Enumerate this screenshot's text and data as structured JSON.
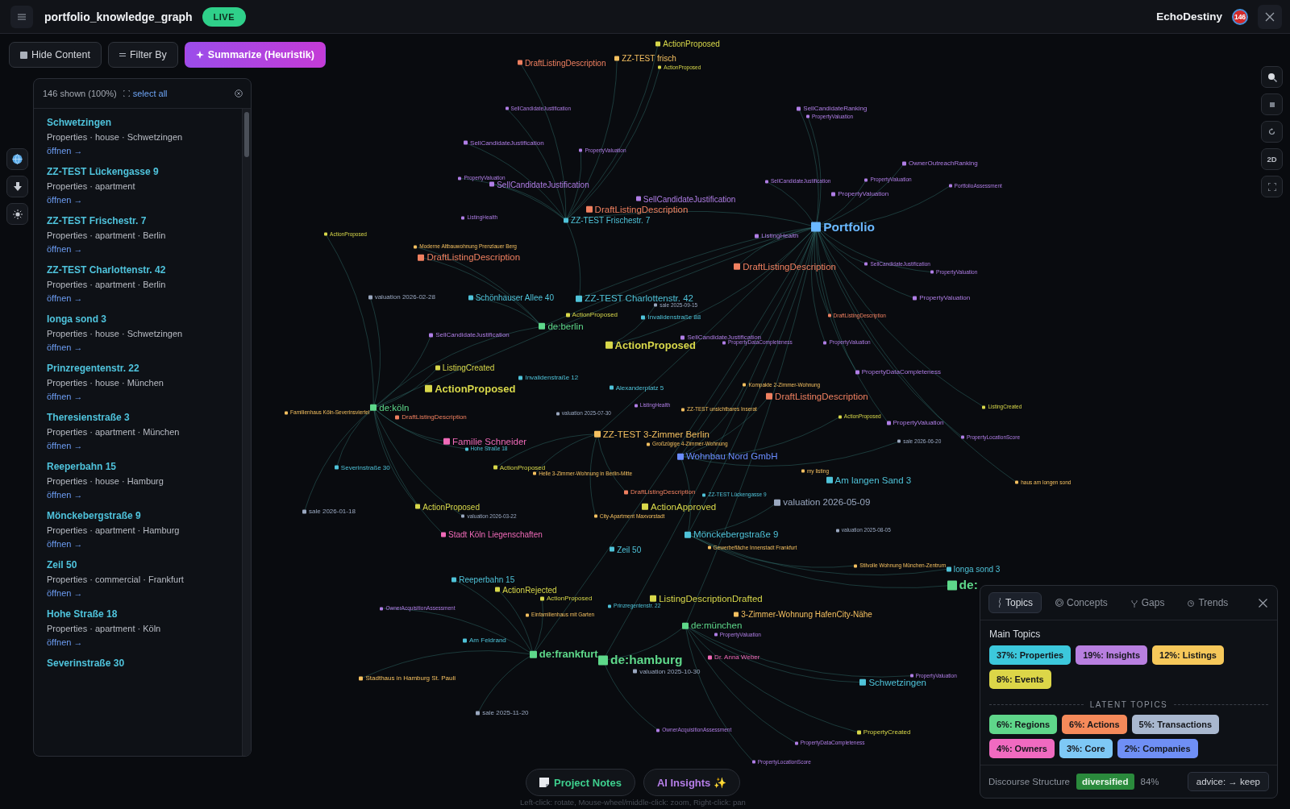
{
  "header": {
    "title": "portfolio_knowledge_graph",
    "status": "LIVE",
    "user": "EchoDestiny",
    "notification_count": "146"
  },
  "toolbar": [
    {
      "label": "Hide Content",
      "kind": "hide"
    },
    {
      "label": "Filter By",
      "kind": "filter"
    },
    {
      "label": "Summarize (Heuristik)",
      "kind": "summarize"
    }
  ],
  "list": {
    "count": "146 shown (100%)",
    "select_all": "select all",
    "items": [
      {
        "title": "Schwetzingen",
        "meta": "Properties · house · Schwetzingen",
        "link": "öffnen →"
      },
      {
        "title": "ZZ-TEST Lückengasse 9",
        "meta": "Properties · apartment",
        "link": "öffnen →"
      },
      {
        "title": "ZZ-TEST Frischestr. 7",
        "meta": "Properties · apartment · Berlin",
        "link": "öffnen →"
      },
      {
        "title": "ZZ-TEST Charlottenstr. 42",
        "meta": "Properties · apartment · Berlin",
        "link": "öffnen →"
      },
      {
        "title": "Ionga sond 3",
        "meta": "Properties · house · Schwetzingen",
        "link": "öffnen →"
      },
      {
        "title": "Prinzregentenstr. 22",
        "meta": "Properties · house · München",
        "link": "öffnen →"
      },
      {
        "title": "Theresienstraße 3",
        "meta": "Properties · apartment · München",
        "link": "öffnen →"
      },
      {
        "title": "Reeperbahn 15",
        "meta": "Properties · house · Hamburg",
        "link": "öffnen →"
      },
      {
        "title": "Mönckebergstraße 9",
        "meta": "Properties · apartment · Hamburg",
        "link": "öffnen →"
      },
      {
        "title": "Zeil 50",
        "meta": "Properties · commercial · Frankfurt",
        "link": "öffnen →"
      },
      {
        "title": "Hohe Straße 18",
        "meta": "Properties · apartment · Köln",
        "link": "öffnen →"
      },
      {
        "title": "Severinstraße 30"
      }
    ]
  },
  "view_mode": "2D",
  "graph": {
    "nodes": [
      {
        "label": "ActionProposed",
        "color": "#d8d84a"
      },
      {
        "label": "ZZ-TEST frisch",
        "color": "#f5c060"
      },
      {
        "label": "ActionProposed",
        "color": "#d8d84a"
      },
      {
        "label": "DraftListingDescription",
        "color": "#f08060"
      },
      {
        "label": "SellCandidateJustification",
        "color": "#b07ee6"
      },
      {
        "label": "SellCandidateJustification",
        "color": "#b07ee6"
      },
      {
        "label": "PropertyValuation",
        "color": "#b07ee6"
      },
      {
        "label": "SellCandidateRanking",
        "color": "#b07ee6"
      },
      {
        "label": "PropertyValuation",
        "color": "#b07ee6"
      },
      {
        "label": "OwnerOutreachRanking",
        "color": "#b07ee6"
      },
      {
        "label": "PropertyValuation",
        "color": "#b07ee6"
      },
      {
        "label": "PortfolioAssessment",
        "color": "#b07ee6"
      },
      {
        "label": "SellCandidateJustification",
        "color": "#b07ee6"
      },
      {
        "label": "PropertyValuation",
        "color": "#b07ee6"
      },
      {
        "label": "SellCandidateJustification",
        "color": "#b07ee6"
      },
      {
        "label": "PropertyValuation",
        "color": "#b07ee6"
      },
      {
        "label": "SellCandidateJustification",
        "color": "#b07ee6"
      },
      {
        "label": "ListingHealth",
        "color": "#b07ee6"
      },
      {
        "label": "DraftListingDescription",
        "color": "#f08060"
      },
      {
        "label": "ZZ-TEST Frischestr. 7",
        "color": "#4fc3d9"
      },
      {
        "label": "Portfolio",
        "color": "#6ab8ff"
      },
      {
        "label": "ListingHealth",
        "color": "#b07ee6"
      },
      {
        "label": "ActionProposed",
        "color": "#d8d84a"
      },
      {
        "label": "Moderne Altbauwohnung Prenzlauer Berg",
        "color": "#f5c060"
      },
      {
        "label": "DraftListingDescription",
        "color": "#f08060"
      },
      {
        "label": "DraftListingDescription",
        "color": "#f08060"
      },
      {
        "label": "SellCandidateJustification",
        "color": "#b07ee6"
      },
      {
        "label": "PropertyValuation",
        "color": "#b07ee6"
      },
      {
        "label": "valuation 2026-02-28",
        "color": "#9aa8c0"
      },
      {
        "label": "Schönhauser Allee 40",
        "color": "#4fc3d9"
      },
      {
        "label": "ZZ-TEST Charlottenstr. 42",
        "color": "#4fc3d9"
      },
      {
        "label": "PropertyValuation",
        "color": "#b07ee6"
      },
      {
        "label": "sale 2025-09-15",
        "color": "#9aa8c0"
      },
      {
        "label": "ActionProposed",
        "color": "#d8d84a"
      },
      {
        "label": "Invalidenstraße 88",
        "color": "#4fc3d9"
      },
      {
        "label": "DraftListingDescription",
        "color": "#f08060"
      },
      {
        "label": "de:berlin",
        "color": "#5ed88a"
      },
      {
        "label": "SellCandidateJustification",
        "color": "#b07ee6"
      },
      {
        "label": "ActionProposed",
        "color": "#d8d84a"
      },
      {
        "label": "SellCandidateJustification",
        "color": "#b07ee6"
      },
      {
        "label": "PropertyDataCompleteness",
        "color": "#b07ee6"
      },
      {
        "label": "PropertyValuation",
        "color": "#b07ee6"
      },
      {
        "label": "ListingCreated",
        "color": "#d8d84a"
      },
      {
        "label": "Invalidenstraße 12",
        "color": "#4fc3d9"
      },
      {
        "label": "PropertyDataCompleteness",
        "color": "#b07ee6"
      },
      {
        "label": "ActionProposed",
        "color": "#d8d84a"
      },
      {
        "label": "Alexanderplatz 5",
        "color": "#4fc3d9"
      },
      {
        "label": "Kompakte 2-Zimmer-Wohnung",
        "color": "#f5c060"
      },
      {
        "label": "DraftListingDescription",
        "color": "#f08060"
      },
      {
        "label": "Familienhaus Köln-Severinsviertel",
        "color": "#f5c060"
      },
      {
        "label": "de:köln",
        "color": "#5ed88a"
      },
      {
        "label": "DraftListingDescription",
        "color": "#f08060"
      },
      {
        "label": "valuation 2025-07-30",
        "color": "#9aa8c0"
      },
      {
        "label": "ListingHealth",
        "color": "#b07ee6"
      },
      {
        "label": "ZZ-TEST unsichtbares Inserat",
        "color": "#f5c060"
      },
      {
        "label": "ActionProposed",
        "color": "#d8d84a"
      },
      {
        "label": "PropertyValuation",
        "color": "#b07ee6"
      },
      {
        "label": "ListingCreated",
        "color": "#d8d84a"
      },
      {
        "label": "Familie Schneider",
        "color": "#f06ab8"
      },
      {
        "label": "Hohe Straße 18",
        "color": "#4fc3d9"
      },
      {
        "label": "ZZ-TEST 3-Zimmer Berlin",
        "color": "#f5c060"
      },
      {
        "label": "Großzügige 4-Zimmer-Wohnung",
        "color": "#f5c060"
      },
      {
        "label": "Wohnbau Nord GmbH",
        "color": "#6a8cff"
      },
      {
        "label": "sale 2026-06-20",
        "color": "#9aa8c0"
      },
      {
        "label": "PropertyLocationScore",
        "color": "#b07ee6"
      },
      {
        "label": "Severinstraße 30",
        "color": "#4fc3d9"
      },
      {
        "label": "ActionProposed",
        "color": "#d8d84a"
      },
      {
        "label": "Helle 3-Zimmer-Wohnung in Berlin-Mitte",
        "color": "#f5c060"
      },
      {
        "label": "my listing",
        "color": "#f5c060"
      },
      {
        "label": "Am langen Sand 3",
        "color": "#4fc3d9"
      },
      {
        "label": "haus am longen sond",
        "color": "#f5c060"
      },
      {
        "label": "sale 2026-01-18",
        "color": "#9aa8c0"
      },
      {
        "label": "ActionProposed",
        "color": "#d8d84a"
      },
      {
        "label": "DraftListingDescription",
        "color": "#f08060"
      },
      {
        "label": "ActionApproved",
        "color": "#d8d84a"
      },
      {
        "label": "ZZ-TEST Lückengasse 9",
        "color": "#4fc3d9"
      },
      {
        "label": "valuation 2026-05-09",
        "color": "#9aa8c0"
      },
      {
        "label": "valuation 2026-03-22",
        "color": "#9aa8c0"
      },
      {
        "label": "City-Apartment Maxvorstadt",
        "color": "#f5c060"
      },
      {
        "label": "Stadt Köln Liegenschaften",
        "color": "#f06ab8"
      },
      {
        "label": "Mönckebergstraße 9",
        "color": "#4fc3d9"
      },
      {
        "label": "valuation 2025-08-05",
        "color": "#9aa8c0"
      },
      {
        "label": "Zeil 50",
        "color": "#4fc3d9"
      },
      {
        "label": "Gewerbefläche Innenstadt Frankfurt",
        "color": "#f5c060"
      },
      {
        "label": "Stilvolle Wohnung München-Zentrum",
        "color": "#f5c060"
      },
      {
        "label": "Ionga sond 3",
        "color": "#4fc3d9"
      },
      {
        "label": "Reeperbahn 15",
        "color": "#4fc3d9"
      },
      {
        "label": "ActionRejected",
        "color": "#d8d84a"
      },
      {
        "label": "de:",
        "color": "#5ed88a"
      },
      {
        "label": "ActionProposed",
        "color": "#d8d84a"
      },
      {
        "label": "ListingDescriptionDrafted",
        "color": "#d8d84a"
      },
      {
        "label": "OwnerAcquisitionAssessment",
        "color": "#b07ee6"
      },
      {
        "label": "Einfamilienhaus mit Garten",
        "color": "#f5c060"
      },
      {
        "label": "Prinzregentenstr. 22",
        "color": "#4fc3d9"
      },
      {
        "label": "3-Zimmer-Wohnung HafenCity-Nähe",
        "color": "#f5c060"
      },
      {
        "label": "de:münchen",
        "color": "#5ed88a"
      },
      {
        "label": "PropertyValuation",
        "color": "#b07ee6"
      },
      {
        "label": "Am Feldrand",
        "color": "#4fc3d9"
      },
      {
        "label": "de:frankfurt",
        "color": "#5ed88a"
      },
      {
        "label": "de:hamburg",
        "color": "#5ed88a"
      },
      {
        "label": "Dr. Anna Weber",
        "color": "#f06ab8"
      },
      {
        "label": "Stadthaus in Hamburg St. Pauli",
        "color": "#f5c060"
      },
      {
        "label": "valuation 2025-10-30",
        "color": "#9aa8c0"
      },
      {
        "label": "Schwetzingen",
        "color": "#4fc3d9"
      },
      {
        "label": "PropertyValuation",
        "color": "#b07ee6"
      },
      {
        "label": "sale 2025-11-20",
        "color": "#9aa8c0"
      },
      {
        "label": "OwnerAcquisitionAssessment",
        "color": "#b07ee6"
      },
      {
        "label": "PropertyCreated",
        "color": "#d8d84a"
      },
      {
        "label": "PropertyDataCompleteness",
        "color": "#b07ee6"
      },
      {
        "label": "PropertyLocationScore",
        "color": "#b07ee6"
      }
    ]
  },
  "topics_panel": {
    "tabs": [
      {
        "label": "Topics",
        "kind": "topics",
        "selected": true
      },
      {
        "label": "Concepts",
        "kind": "concepts",
        "selected": false
      },
      {
        "label": "Gaps",
        "kind": "gaps",
        "selected": false
      },
      {
        "label": "Trends",
        "kind": "trends",
        "selected": false
      }
    ],
    "main_title": "Main Topics",
    "main": [
      {
        "label": "37%: Properties",
        "color": "#3cc8dc"
      },
      {
        "label": "19%: Insights",
        "color": "#b87fe0"
      },
      {
        "label": "12%: Listings",
        "color": "#f6c85a"
      },
      {
        "label": "8%: Events",
        "color": "#dcd648"
      }
    ],
    "latent_title": "LATENT TOPICS",
    "latent": [
      {
        "label": "6%: Regions",
        "color": "#5fd68a"
      },
      {
        "label": "6%: Actions",
        "color": "#f58a5a"
      },
      {
        "label": "5%: Transactions",
        "color": "#a9b8cf"
      },
      {
        "label": "4%: Owners",
        "color": "#f06ac0"
      },
      {
        "label": "3%: Core",
        "color": "#7ec8f5"
      },
      {
        "label": "2%: Companies",
        "color": "#6f8ff5"
      }
    ],
    "footer": {
      "label": "Discourse Structure",
      "state": "diversified",
      "percent": "84%",
      "advice": "advice: → keep"
    }
  },
  "bottom": {
    "buttons": [
      {
        "label": "Project Notes",
        "kind": "notes"
      },
      {
        "label": "AI Insights ✨",
        "kind": "ai"
      }
    ],
    "hint": "Left-click: rotate, Mouse-wheel/middle-click: zoom, Right-click: pan"
  }
}
